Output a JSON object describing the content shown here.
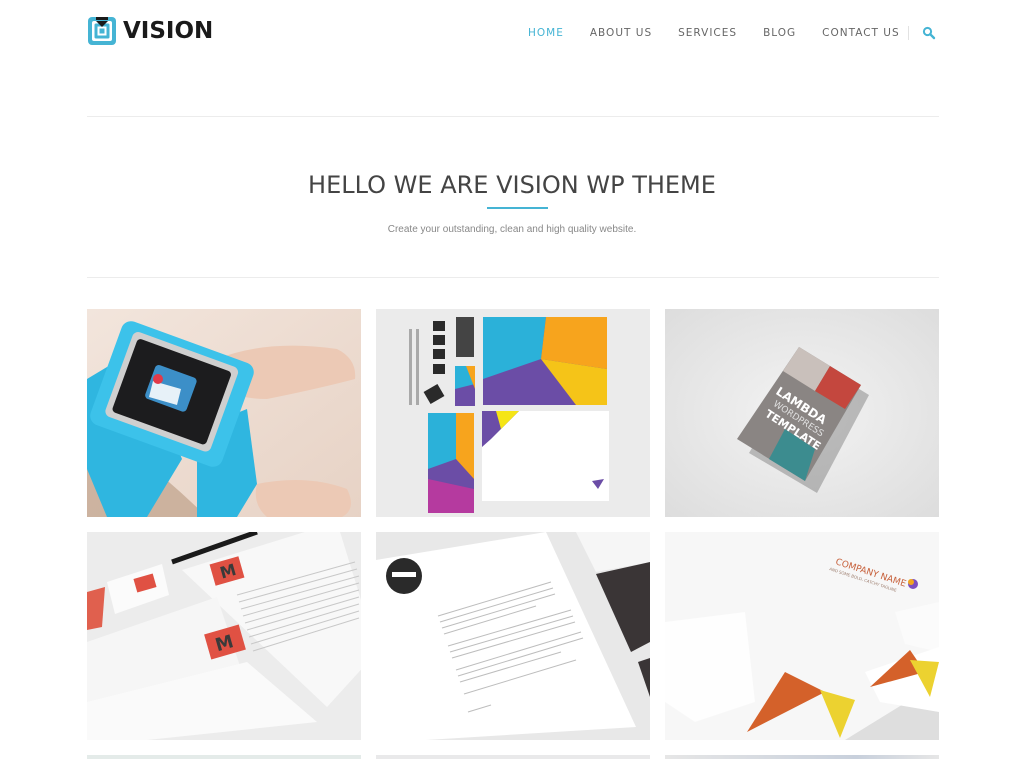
{
  "brand": {
    "name": "VISION",
    "accent_color": "#45b4d4",
    "logo_icon": "concentric-square-logo-icon"
  },
  "nav": {
    "items": [
      {
        "label": "HOME",
        "active": true
      },
      {
        "label": "ABOUT US",
        "active": false
      },
      {
        "label": "SERVICES",
        "active": false
      },
      {
        "label": "BLOG",
        "active": false
      },
      {
        "label": "CONTACT US",
        "active": false
      }
    ],
    "search_icon": "search-icon"
  },
  "hero": {
    "title": "HELLO WE ARE VISION WP THEME",
    "subtitle": "Create your outstanding, clean and high quality website."
  },
  "portfolio": {
    "items": [
      {
        "label": "Smartwatch with mail notification"
      },
      {
        "label": "Colorful geometric stationery set"
      },
      {
        "label": "Lambda WordPress Template brochure",
        "cover_text": [
          "LAMBDA",
          "WORDPRESS",
          "TEMPLATE"
        ]
      },
      {
        "label": "Red M logo corporate identity stationery"
      },
      {
        "label": "Black and white letterhead with envelopes"
      },
      {
        "label": "Orange and yellow company stationery",
        "cover_text": [
          "COMPANY NAME",
          "AND SOME BOLD, CATCHY TAGLINE"
        ]
      },
      {
        "label": "Portfolio item 7"
      },
      {
        "label": "Portfolio item 8"
      },
      {
        "label": "Portfolio item 9"
      }
    ]
  }
}
